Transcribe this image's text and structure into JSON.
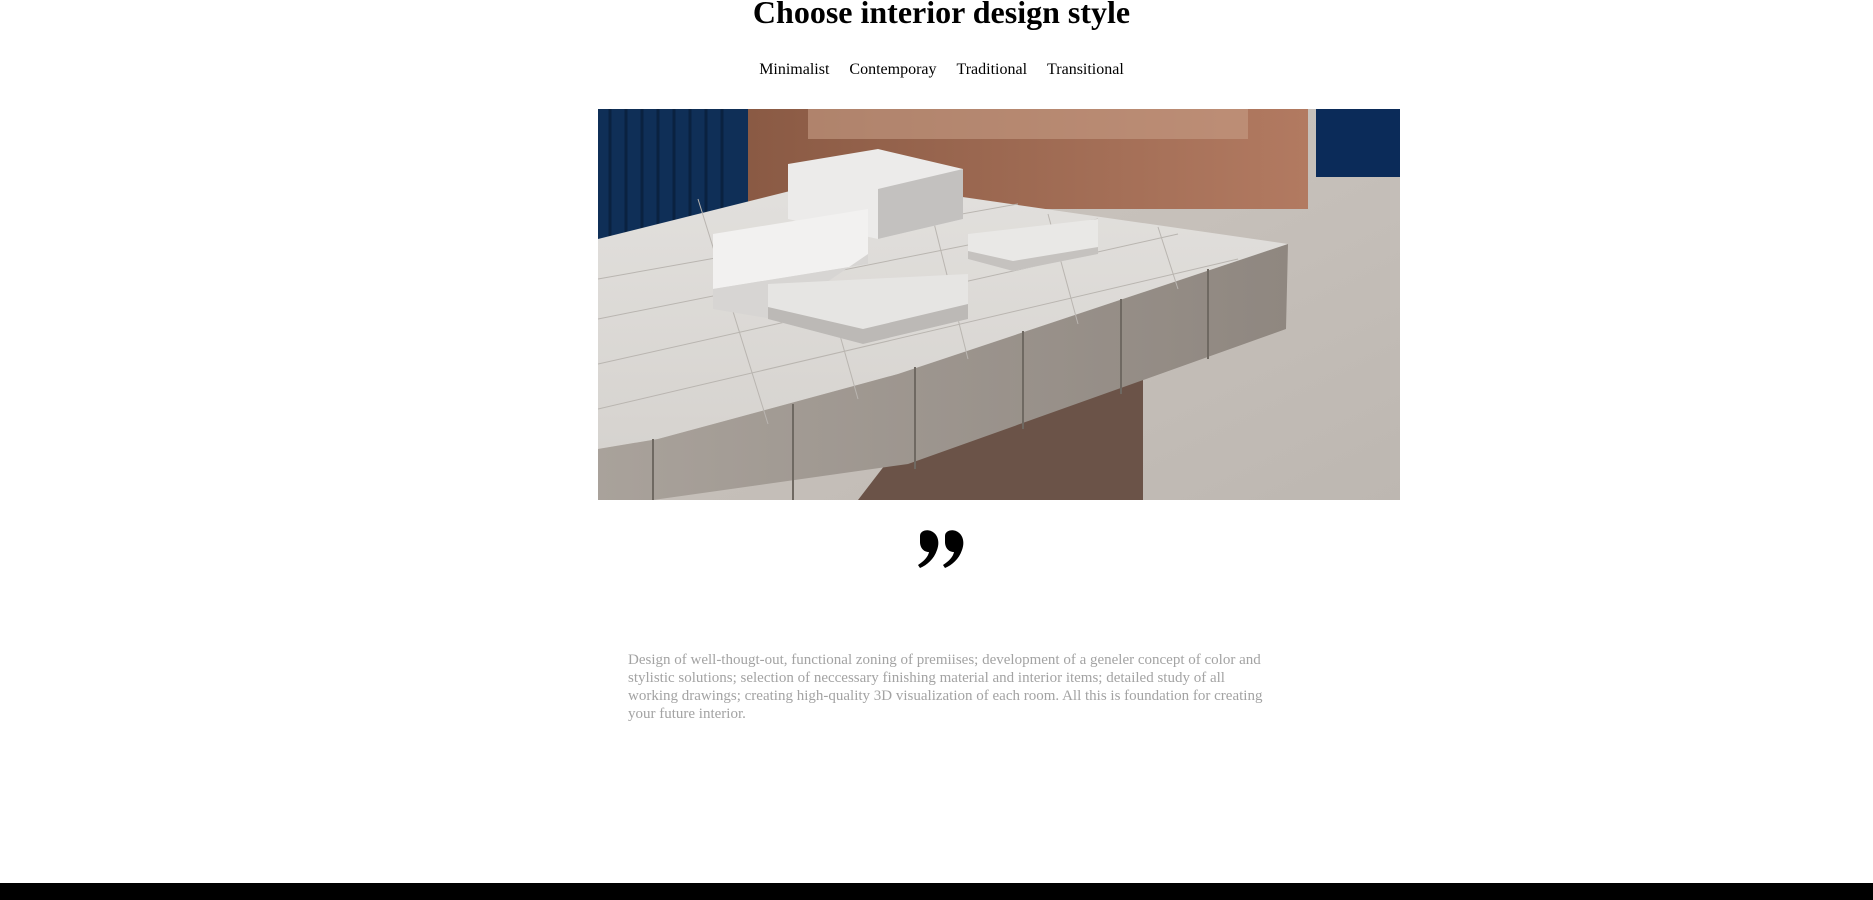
{
  "header": {
    "title": "Choose interior design style"
  },
  "tabs": [
    {
      "label": "Minimalist"
    },
    {
      "label": "Contemporay"
    },
    {
      "label": "Traditional"
    },
    {
      "label": "Transitional"
    }
  ],
  "content": {
    "description": "Design of well-thougt-out, functional zoning of premiises; development of a geneler concept of color and stylistic solutions; selection of neccessary finishing material and interior items; detailed study of all working drawings; creating high-quality 3D visualization of each room. All this is foundation for creating your future interior."
  },
  "colors": {
    "text": "#000000",
    "description": "#a3a3a3",
    "footer": "#000000"
  }
}
